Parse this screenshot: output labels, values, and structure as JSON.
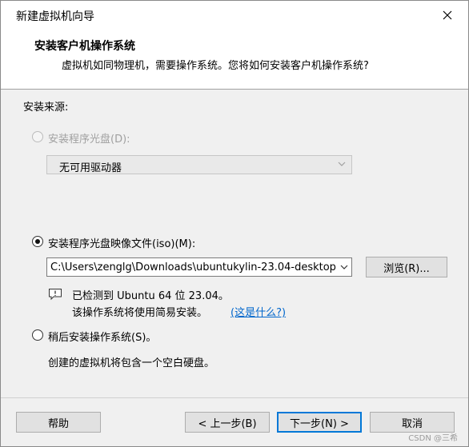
{
  "window": {
    "title": "新建虚拟机向导"
  },
  "header": {
    "title": "安装客户机操作系统",
    "subtitle": "虚拟机如同物理机，需要操作系统。您将如何安装客户机操作系统?"
  },
  "source": {
    "label": "安装来源:",
    "disc_option": {
      "label": "安装程序光盘(D):",
      "selected": false,
      "enabled": false
    },
    "disc_drive_select": {
      "value": "无可用驱动器",
      "enabled": false
    },
    "iso_option": {
      "label": "安装程序光盘映像文件(iso)(M):",
      "selected": true
    },
    "iso_path": {
      "value": "C:\\Users\\zenglg\\Downloads\\ubuntukylin-23.04-desktop"
    },
    "browse_label": "浏览(R)...",
    "detect_line1": "已检测到 Ubuntu 64 位 23.04。",
    "detect_line2": "该操作系统将使用简易安装。",
    "what_link": "(这是什么?)",
    "later_option": {
      "label": "稍后安装操作系统(S)。",
      "selected": false
    },
    "later_desc": "创建的虚拟机将包含一个空白硬盘。"
  },
  "footer": {
    "help": "帮助",
    "back": "< 上一步(B)",
    "next": "下一步(N) >",
    "cancel": "取消"
  },
  "watermark": "CSDN @三希"
}
